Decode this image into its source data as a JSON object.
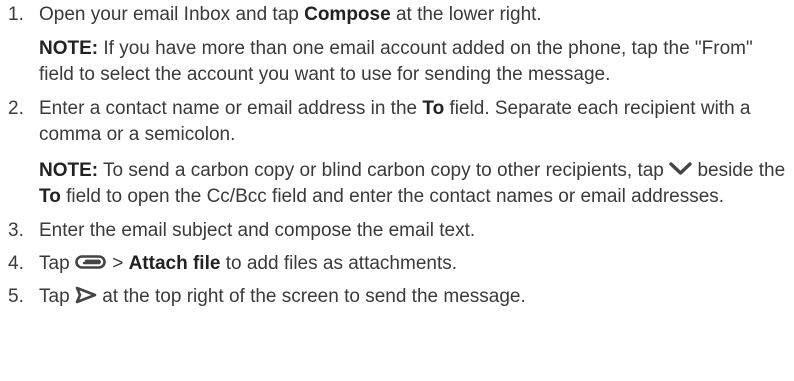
{
  "steps": [
    {
      "num": "1.",
      "pre": "Open your email Inbox and tap ",
      "bold": "Compose",
      "post": " at the lower right.",
      "note": {
        "label": "NOTE:",
        "text": " If you have more than one email account added on the phone, tap the \"From\" field to select the account you want to use for sending the message."
      }
    },
    {
      "num": "2.",
      "pre": "Enter a contact name or email address in the ",
      "bold": "To",
      "post": " field. Separate each recipient with a comma or a semicolon.",
      "note": {
        "label": "NOTE:",
        "pre": " To send a carbon copy or blind carbon copy to other recipients, tap ",
        "icon": "chevron-down-icon",
        "mid": " beside the ",
        "bold": "To",
        "post": " field to open the Cc/Bcc field and enter the contact names or email addresses."
      }
    },
    {
      "num": "3.",
      "text": "Enter the email subject and compose the email text."
    },
    {
      "num": "4.",
      "pre": "Tap ",
      "icon": "paperclip-icon",
      "sep": " > ",
      "bold": "Attach file",
      "post": " to add files as attachments."
    },
    {
      "num": "5.",
      "pre": "Tap ",
      "icon": "send-icon",
      "post": " at the top right of the screen to send the message."
    }
  ],
  "colors": {
    "text": "#3a3a3a",
    "bold": "#222222",
    "icon": "#444444"
  }
}
